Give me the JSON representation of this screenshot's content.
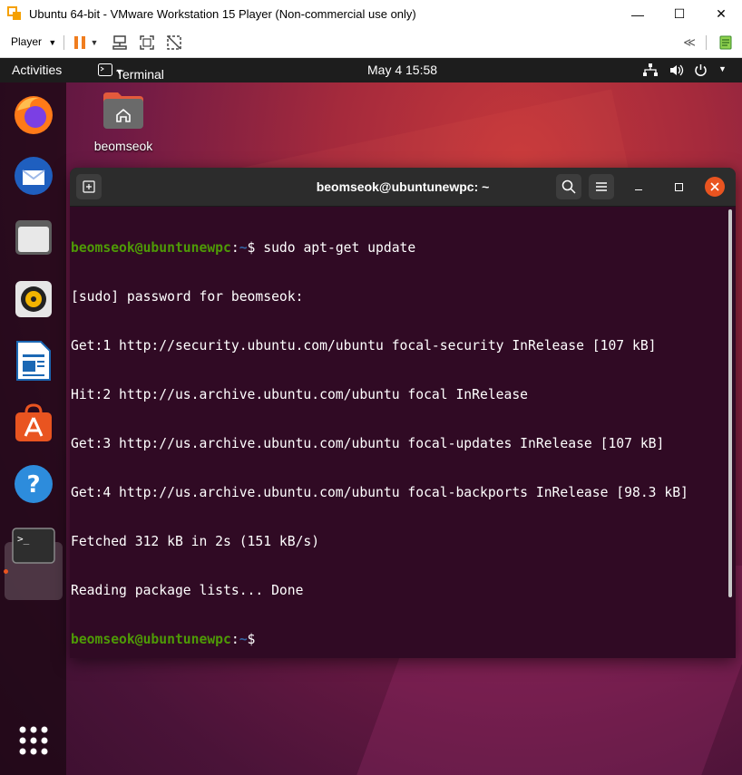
{
  "vmware": {
    "title": "Ubuntu 64-bit - VMware Workstation 15 Player (Non-commercial use only)",
    "player_menu": "Player",
    "minimize": "—",
    "maximize": "☐",
    "close": "✕",
    "back_label": "≪"
  },
  "topbar": {
    "activities": "Activities",
    "app_menu": "Terminal",
    "datetime": "May 4  15:58"
  },
  "desktop": {
    "home_folder_label": "beomseok"
  },
  "terminal": {
    "title": "beomseok@ubuntunewpc: ~",
    "lines": [
      {
        "user": "beomseok@ubuntunewpc",
        "path": "~",
        "text": "$ sudo apt-get update"
      },
      {
        "text": "[sudo] password for beomseok:"
      },
      {
        "text": "Get:1 http://security.ubuntu.com/ubuntu focal-security InRelease [107 kB]"
      },
      {
        "text": "Hit:2 http://us.archive.ubuntu.com/ubuntu focal InRelease"
      },
      {
        "text": "Get:3 http://us.archive.ubuntu.com/ubuntu focal-updates InRelease [107 kB]"
      },
      {
        "text": "Get:4 http://us.archive.ubuntu.com/ubuntu focal-backports InRelease [98.3 kB]"
      },
      {
        "text": "Fetched 312 kB in 2s (151 kB/s)"
      },
      {
        "text": "Reading package lists... Done"
      },
      {
        "user": "beomseok@ubuntunewpc",
        "path": "~",
        "text": "$"
      }
    ]
  },
  "dock": {
    "items": [
      "firefox-icon",
      "thunderbird-icon",
      "files-icon",
      "rhythmbox-icon",
      "libreoffice-writer-icon",
      "ubuntu-software-icon",
      "help-icon",
      "terminal-icon"
    ],
    "show_apps": "show-applications-icon"
  },
  "colors": {
    "terminal_bg": "#300a24",
    "prompt_user": "#4e9a06",
    "prompt_path": "#3465a4",
    "accent": "#e95420"
  }
}
